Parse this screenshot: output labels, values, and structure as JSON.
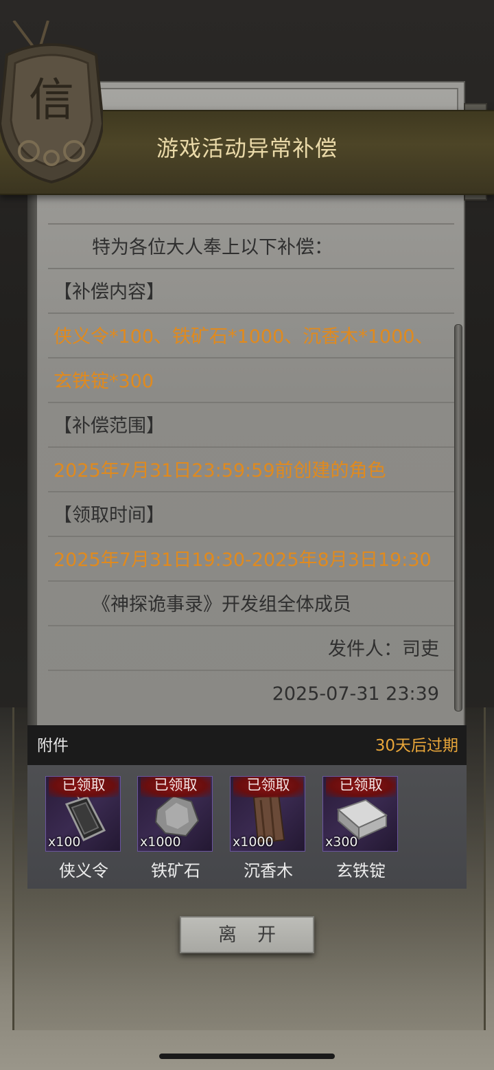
{
  "badge": {
    "glyph": "信"
  },
  "title": "游戏活动异常补偿",
  "mail": {
    "lines": [
      {
        "text": "特为各位大人奉上以下补偿：",
        "style": "indent"
      },
      {
        "text": "【补偿内容】",
        "style": "normal"
      },
      {
        "text": "侠义令*100、铁矿石*1000、沉香木*1000、",
        "style": "orange"
      },
      {
        "text": "玄铁锭*300",
        "style": "orange"
      },
      {
        "text": "【补偿范围】",
        "style": "normal"
      },
      {
        "text": "2025年7月31日23:59:59前创建的角色",
        "style": "orange"
      },
      {
        "text": "【领取时间】",
        "style": "normal"
      },
      {
        "text": "2025年7月31日19:30-2025年8月3日19:30",
        "style": "orange"
      },
      {
        "text": "《神探诡事录》开发组全体成员",
        "style": "indent"
      },
      {
        "text": "发件人：司吏",
        "style": "right"
      },
      {
        "text": "2025-07-31 23:39",
        "style": "right"
      }
    ]
  },
  "attachments": {
    "label": "附件",
    "expire": "30天后过期",
    "items": [
      {
        "name": "侠义令",
        "qty": "x100",
        "status": "已领取",
        "icon": "token-icon"
      },
      {
        "name": "铁矿石",
        "qty": "x1000",
        "status": "已领取",
        "icon": "iron-ore-icon"
      },
      {
        "name": "沉香木",
        "qty": "x1000",
        "status": "已领取",
        "icon": "agarwood-icon"
      },
      {
        "name": "玄铁锭",
        "qty": "x300",
        "status": "已领取",
        "icon": "iron-ingot-icon"
      }
    ]
  },
  "leave_button": "离开"
}
